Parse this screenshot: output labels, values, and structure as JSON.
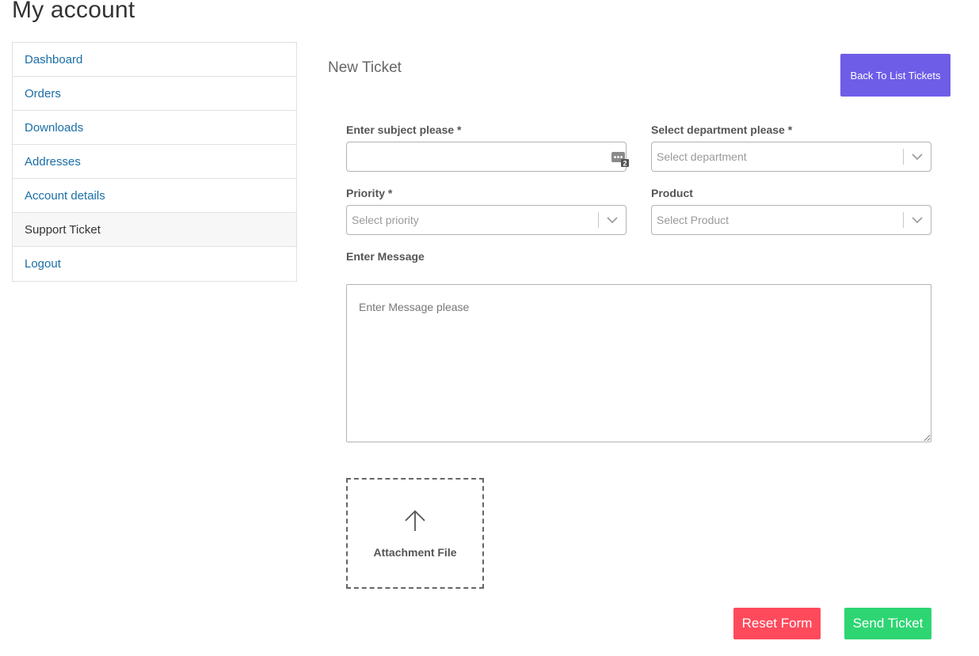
{
  "page": {
    "title": "My account"
  },
  "sidebar": {
    "items": [
      {
        "label": "Dashboard"
      },
      {
        "label": "Orders"
      },
      {
        "label": "Downloads"
      },
      {
        "label": "Addresses"
      },
      {
        "label": "Account details"
      },
      {
        "label": "Support Ticket",
        "active": true
      },
      {
        "label": "Logout"
      }
    ]
  },
  "ticket": {
    "title": "New Ticket",
    "back_label": "Back To List Tickets",
    "subject": {
      "label": "Enter subject please *",
      "value": "",
      "icon": "password-manager-icon",
      "badge": "2"
    },
    "department": {
      "label": "Select department please *",
      "placeholder": "Select department"
    },
    "priority": {
      "label": "Priority *",
      "placeholder": "Select priority"
    },
    "product": {
      "label": "Product",
      "placeholder": "Select Product"
    },
    "message": {
      "label": "Enter Message",
      "placeholder": "Enter Message please"
    },
    "attachment": {
      "label": "Attachment File",
      "icon": "upload-arrow-icon"
    },
    "reset_label": "Reset Form",
    "send_label": "Send Ticket"
  },
  "colors": {
    "link": "#1a6ea6",
    "primary": "#6e5de7",
    "danger": "#ff4a5c",
    "success": "#2ed573"
  }
}
